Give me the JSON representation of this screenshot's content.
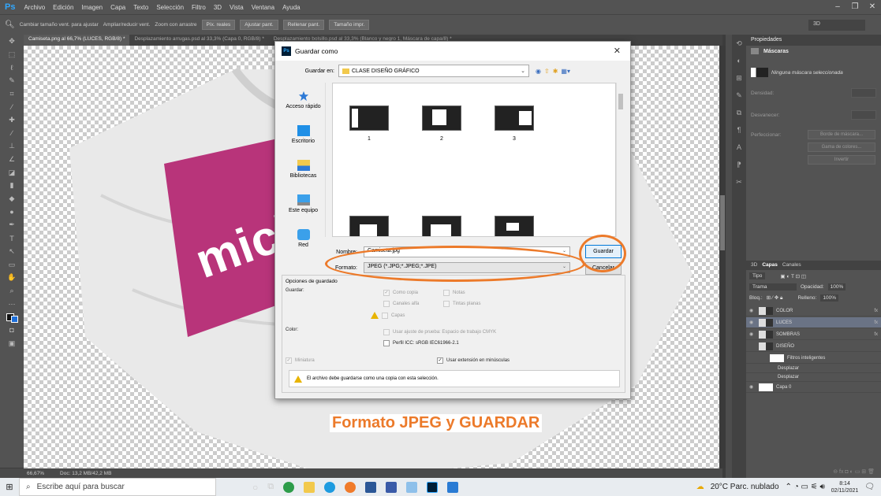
{
  "app": {
    "logo": "Ps",
    "menu": [
      "Archivo",
      "Edición",
      "Imagen",
      "Capa",
      "Texto",
      "Selección",
      "Filtro",
      "3D",
      "Vista",
      "Ventana",
      "Ayuda"
    ]
  },
  "options": {
    "checks": [
      "Cambiar tamaño vent. para ajustar",
      "Ampliar/reducir vent.",
      "Zoom con arrastre"
    ],
    "buttons": [
      "Píx. reales",
      "Ajustar pant.",
      "Rellenar pant.",
      "Tamaño impr."
    ],
    "workspace": "3D"
  },
  "tabs": [
    "Camiseta.png al 66,7% (LUCES, RGB/8) *",
    "Desplazamiento arrugas.psd al 33,3% (Capa 0, RGB/8) *",
    "Desplazamiento bolsillo.psd al 33,3% (Blanco y negro 1, Máscara de capa/8) *"
  ],
  "status": {
    "zoom": "66,67%",
    "doc": "Doc: 13,2 MB/42,2 MB"
  },
  "canvas": {
    "shirt_text": "mich"
  },
  "properties": {
    "title": "Propiedades",
    "section": "Máscaras",
    "no_mask": "Ninguna máscara seleccionada",
    "density": "Densidad:",
    "feather": "Desvanecer:",
    "refine": "Perfeccionar:",
    "btn_edge": "Borde de máscara...",
    "btn_color": "Gama de colores...",
    "btn_invert": "Invertir"
  },
  "layers": {
    "tabs": [
      "3D",
      "Capas",
      "Canales"
    ],
    "kind": "Tipo",
    "mode": "Trama",
    "opacity_label": "Opacidad:",
    "opacity": "100%",
    "lock_label": "Bloq.:",
    "fill_label": "Relleno:",
    "fill": "100%",
    "items": [
      {
        "name": "COLOR",
        "fx": "fx"
      },
      {
        "name": "LUCES",
        "fx": "fx"
      },
      {
        "name": "SOMBRAS",
        "fx": "fx"
      },
      {
        "name": "DISEÑO",
        "fx": ""
      },
      {
        "name": "Filtros inteligentes",
        "fx": ""
      },
      {
        "name": "Desplazar",
        "fx": ""
      },
      {
        "name": "Desplazar",
        "fx": ""
      },
      {
        "name": "Capa 0",
        "fx": ""
      }
    ]
  },
  "dialog": {
    "title": "Guardar como",
    "save_in_label": "Guardar en:",
    "save_in": "CLASE DISEÑO GRÁFICO",
    "places": [
      "Acceso rápido",
      "Escritorio",
      "Bibliotecas",
      "Este equipo",
      "Red"
    ],
    "thumbs": [
      "1",
      "2",
      "3"
    ],
    "name_label": "Nombre:",
    "name": "Camiseta.jpg",
    "format_label": "Formato:",
    "format": "JPEG (*.JPG;*.JPEG;*.JPE)",
    "save": "Guardar",
    "cancel": "Cancelar",
    "options_title": "Opciones de guardado",
    "save_label": "Guardar:",
    "as_copy": "Como copia",
    "notes": "Notas",
    "alpha": "Canales alfa",
    "spot": "Tintas planas",
    "layers": "Capas",
    "color_label": "Color:",
    "proof": "Usar ajuste de prueba: Espacio de trabajo CMYK",
    "icc": "Perfil ICC: sRGB IEC61966-2.1",
    "thumbnail": "Miniatura",
    "lowercase": "Usar extensión en minúsculas",
    "warning": "El archivo debe guardarse como una copia con esta selección."
  },
  "caption": "Formato JPEG y GUARDAR",
  "taskbar": {
    "search": "Escribe aquí para buscar",
    "weather": "20°C Parc. nublado",
    "time": "8:14",
    "date": "02/11/2021"
  },
  "colors": {
    "accent": "#ec7a2a",
    "magenta": "#b8347a",
    "ps_blue": "#31a8ff"
  }
}
